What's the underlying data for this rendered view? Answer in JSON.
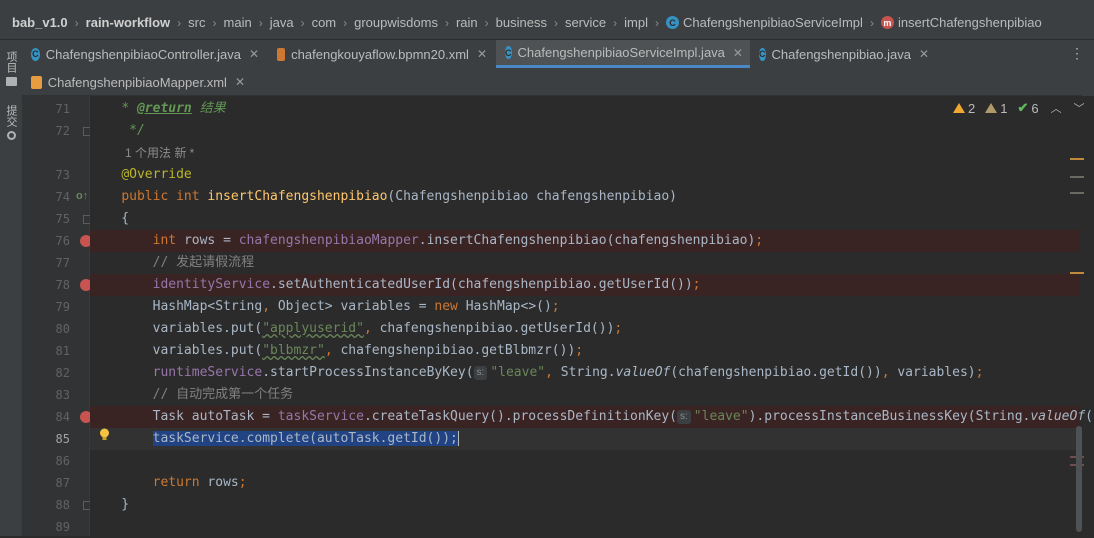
{
  "breadcrumb": {
    "items": [
      {
        "label": "bab_v1.0",
        "bold": true
      },
      {
        "label": "rain-workflow",
        "bold": true
      },
      {
        "label": "src"
      },
      {
        "label": "main"
      },
      {
        "label": "java"
      },
      {
        "label": "com"
      },
      {
        "label": "groupwisdoms"
      },
      {
        "label": "rain"
      },
      {
        "label": "business"
      },
      {
        "label": "service"
      },
      {
        "label": "impl"
      },
      {
        "label": "ChafengshenpibiaoServiceImpl",
        "icon": "class-icon"
      },
      {
        "label": "insertChafengshenpibiao",
        "icon": "method-icon"
      }
    ]
  },
  "left_strip": {
    "project_label": "项目",
    "commit_label": "提交"
  },
  "tabs": [
    {
      "label": "ChafengshenpibiaoController.java",
      "icon": "class-icon",
      "active": false
    },
    {
      "label": "chafengkouyaflow.bpmn20.xml",
      "icon": "bpmn-icon",
      "active": false
    },
    {
      "label": "ChafengshenpibiaoServiceImpl.java",
      "icon": "class-icon",
      "active": true
    },
    {
      "label": "Chafengshenpibiao.java",
      "icon": "class-icon",
      "active": false
    },
    {
      "label": "ChafengshenpibiaoMapper.xml",
      "icon": "xml-icon",
      "active": false
    }
  ],
  "inspections": {
    "warnings": "2",
    "weak_warnings": "1",
    "ok": "6"
  },
  "code": {
    "usage_hint": "1 个用法  新 *",
    "line_numbers": [
      "71",
      "72",
      "73",
      "74",
      "75",
      "76",
      "77",
      "78",
      "79",
      "80",
      "81",
      "82",
      "83",
      "84",
      "85",
      "86",
      "87",
      "88",
      "89"
    ],
    "doc_return_tag": "@return",
    "doc_return_text": "结果",
    "doc_close": "*/",
    "annotation": "@Override",
    "method_name": "insertChafengshenpibiao",
    "method_params": "(Chafengshenpibiao chafengshenpibiao)",
    "comment_1": "// 发起请假流程",
    "comment_2": "// 自动完成第一个任务",
    "param_hint": "s:",
    "string_leave": "\"leave\"",
    "string_applyuserid": "\"applyuserid\"",
    "string_blbmzr": "\"blbmzr\"",
    "selected_line": "taskService.complete(autoTask.getId());"
  }
}
